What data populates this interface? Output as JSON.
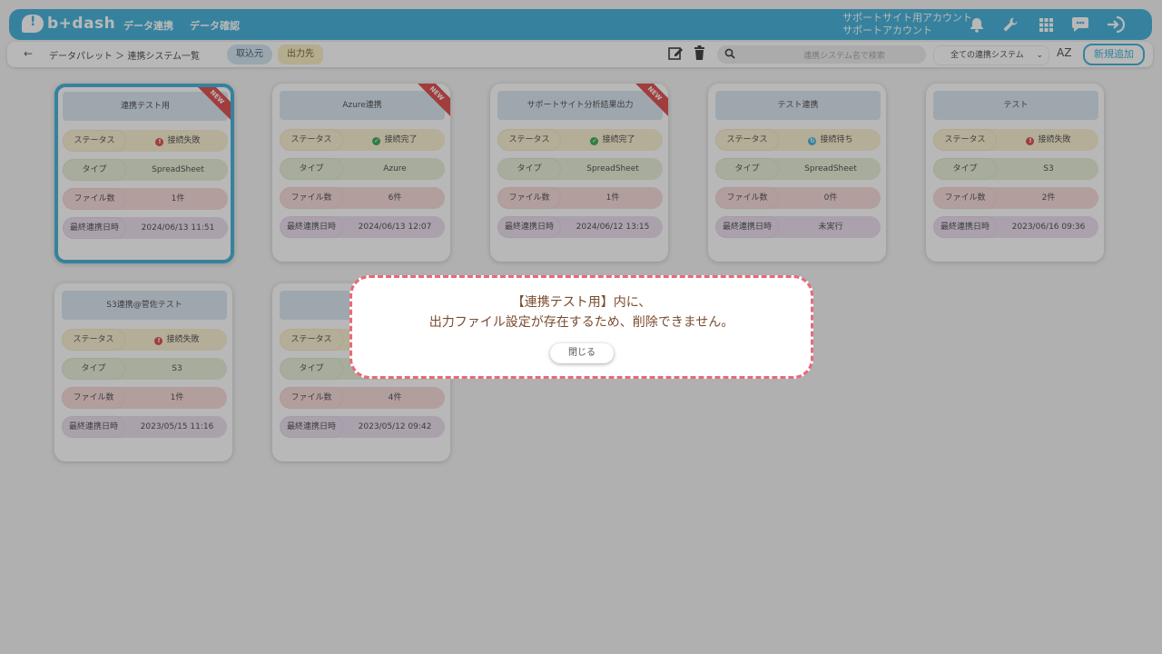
{
  "header": {
    "logo_text": "b+dash",
    "nav": [
      "データ連携",
      "データ確認"
    ],
    "account_line1": "サポートサイト用アカウント",
    "account_line2": "サポートアカウント",
    "icons": [
      "bell-icon",
      "wrench-icon",
      "apps-grid-icon",
      "chat-icon",
      "logout-icon"
    ]
  },
  "subbar": {
    "back_icon": "←",
    "breadcrumb": "データパレット ＞ 連携システム一覧",
    "tab_in": "取込元",
    "tab_out": "出力先",
    "search_placeholder": "連携システム名で検索",
    "filter_selected": "全ての連携システム",
    "sort_label": "AZ",
    "new_button": "新規追加"
  },
  "labels": {
    "status": "ステータス",
    "type": "タイプ",
    "files": "ファイル数",
    "last_sync": "最終連携日時"
  },
  "cards": [
    {
      "title": "連携テスト用",
      "status": "接続失敗",
      "status_kind": "fail",
      "type": "SpreadSheet",
      "files": "1件",
      "last_sync": "2024/06/13 11:51",
      "new": "NEW",
      "selected": true
    },
    {
      "title": "Azure連携",
      "status": "接続完了",
      "status_kind": "ok",
      "type": "Azure",
      "files": "6件",
      "last_sync": "2024/06/13 12:07",
      "new": "NEW",
      "selected": false
    },
    {
      "title": "サポートサイト分析結果出力",
      "status": "接続完了",
      "status_kind": "ok",
      "type": "SpreadSheet",
      "files": "1件",
      "last_sync": "2024/06/12 13:15",
      "new": "NEW",
      "selected": false
    },
    {
      "title": "テスト連携",
      "status": "接続待ち",
      "status_kind": "wait",
      "type": "SpreadSheet",
      "files": "0件",
      "last_sync": "未実行",
      "new": "",
      "selected": false
    },
    {
      "title": "テスト",
      "status": "接続失敗",
      "status_kind": "fail",
      "type": "S3",
      "files": "2件",
      "last_sync": "2023/06/16 09:36",
      "new": "",
      "selected": false
    },
    {
      "title": "S3連携@菅佐テスト",
      "status": "接続失敗",
      "status_kind": "fail",
      "type": "S3",
      "files": "1件",
      "last_sync": "2023/05/15 11:16",
      "new": "",
      "selected": false
    },
    {
      "title": "",
      "status": "",
      "status_kind": "",
      "type": "",
      "files": "4件",
      "last_sync": "2023/05/12 09:42",
      "new": "",
      "selected": false
    }
  ],
  "modal": {
    "line1": "【連携テスト用】内に、",
    "line2": "出力ファイル設定が存在するため、削除できません。",
    "close_button": "閉じる"
  },
  "colors": {
    "accent": "#4bb4dc",
    "fail": "#e05555",
    "ok": "#3fae5f",
    "modal_border": "#e86a78"
  }
}
